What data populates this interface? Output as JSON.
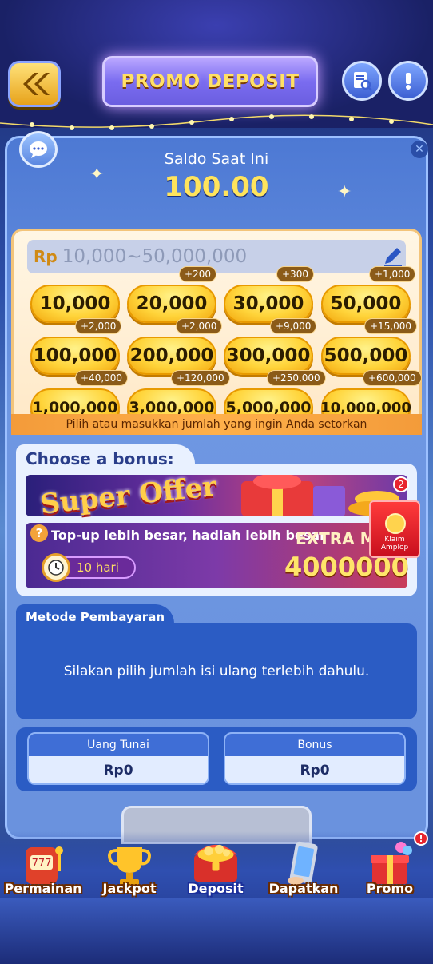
{
  "header": {
    "title": "PROMO DEPOSIT",
    "back_icon": "double-chevron-left-icon",
    "history_icon": "document-search-icon",
    "info_icon": "exclamation-icon"
  },
  "balance": {
    "label": "Saldo Saat Ini",
    "value": "100.00"
  },
  "amount": {
    "currency": "Rp",
    "placeholder": "10,000~50,000,000",
    "hint": "Pilih atau masukkan jumlah yang ingin Anda setorkan",
    "options": [
      {
        "value": "10,000",
        "bonus": ""
      },
      {
        "value": "20,000",
        "bonus": "+200"
      },
      {
        "value": "30,000",
        "bonus": "+300"
      },
      {
        "value": "50,000",
        "bonus": "+1,000"
      },
      {
        "value": "100,000",
        "bonus": "+2,000"
      },
      {
        "value": "200,000",
        "bonus": "+2,000"
      },
      {
        "value": "300,000",
        "bonus": "+9,000"
      },
      {
        "value": "500,000",
        "bonus": "+15,000"
      },
      {
        "value": "1,000,000",
        "bonus": "+40,000"
      },
      {
        "value": "3,000,000",
        "bonus": "+120,000"
      },
      {
        "value": "5,000,000",
        "bonus": "+250,000"
      },
      {
        "value": "10,000,000",
        "bonus": "+600,000"
      }
    ]
  },
  "bonus": {
    "heading": "Choose a bonus:",
    "super_offer": "Super Offer",
    "topup_text": "Top-up lebih besar, hadiah lebih besar",
    "extra_label": "EXTRA MA",
    "extra_value": "4000000",
    "timer": "10 hari",
    "envelope_label": "Klaim Amplop",
    "envelope_badge": "2"
  },
  "payment": {
    "heading": "Metode Pembayaran",
    "message": "Silakan pilih jumlah isi ulang terlebih dahulu."
  },
  "summary": {
    "cash_label": "Uang Tunai",
    "cash_value": "Rp0",
    "bonus_label": "Bonus",
    "bonus_value": "Rp0"
  },
  "nav": {
    "items": [
      {
        "label": "Permainan",
        "icon": "slot-machine-icon"
      },
      {
        "label": "Jackpot",
        "icon": "trophy-icon"
      },
      {
        "label": "Deposit",
        "icon": "treasure-chest-icon"
      },
      {
        "label": "Dapatkan",
        "icon": "phone-icon"
      },
      {
        "label": "Promo",
        "icon": "gift-icon"
      }
    ],
    "promo_badge": "!"
  }
}
